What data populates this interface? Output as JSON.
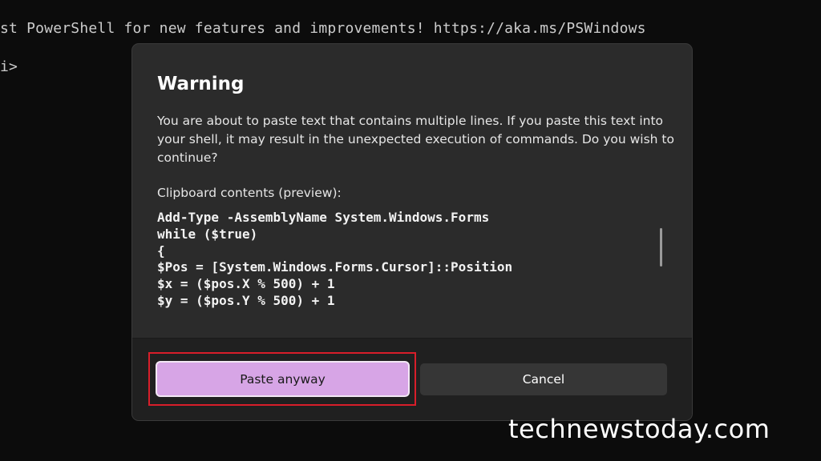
{
  "terminal": {
    "lines": [
      "st PowerShell for new features and improvements! https://aka.ms/PSWindows",
      "i>"
    ]
  },
  "dialog": {
    "title": "Warning",
    "message": "You are about to paste text that contains multiple lines. If you paste this text into your shell, it may result in the unexpected execution of commands. Do you wish to continue?",
    "clipboard_label": "Clipboard contents (preview):",
    "clipboard_lines": [
      "Add-Type -AssemblyName System.Windows.Forms",
      "while ($true)",
      "{",
      "$Pos = [System.Windows.Forms.Cursor]::Position",
      "$x = ($pos.X % 500) + 1",
      "$y = ($pos.Y % 500) + 1"
    ],
    "paste_button_label": "Paste anyway",
    "cancel_button_label": "Cancel"
  },
  "watermark": "technewstoday.com",
  "colors": {
    "paste_button_bg": "#d7a5e6",
    "highlight_border": "#d81e2a",
    "dialog_bg": "#2b2b2b",
    "footer_bg": "#202020",
    "terminal_bg": "#0c0c0c"
  }
}
